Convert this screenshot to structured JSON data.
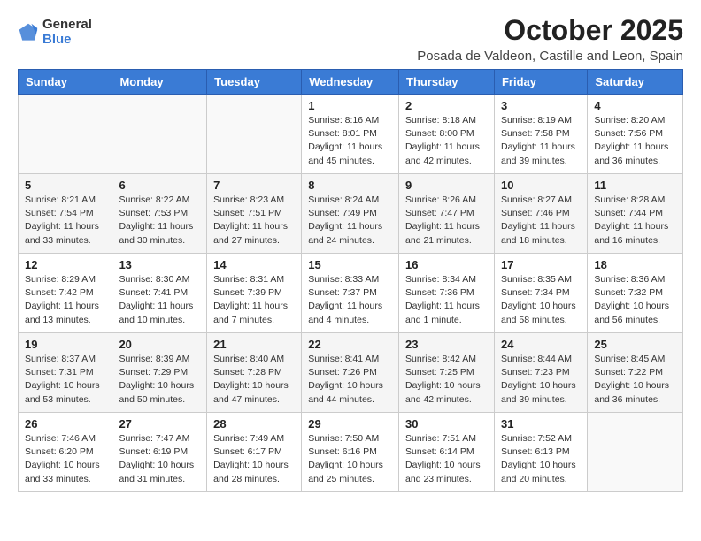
{
  "header": {
    "logo_general": "General",
    "logo_blue": "Blue",
    "title": "October 2025",
    "subtitle": "Posada de Valdeon, Castille and Leon, Spain"
  },
  "weekdays": [
    "Sunday",
    "Monday",
    "Tuesday",
    "Wednesday",
    "Thursday",
    "Friday",
    "Saturday"
  ],
  "weeks": [
    [
      {
        "day": "",
        "info": ""
      },
      {
        "day": "",
        "info": ""
      },
      {
        "day": "",
        "info": ""
      },
      {
        "day": "1",
        "info": "Sunrise: 8:16 AM\nSunset: 8:01 PM\nDaylight: 11 hours and 45 minutes."
      },
      {
        "day": "2",
        "info": "Sunrise: 8:18 AM\nSunset: 8:00 PM\nDaylight: 11 hours and 42 minutes."
      },
      {
        "day": "3",
        "info": "Sunrise: 8:19 AM\nSunset: 7:58 PM\nDaylight: 11 hours and 39 minutes."
      },
      {
        "day": "4",
        "info": "Sunrise: 8:20 AM\nSunset: 7:56 PM\nDaylight: 11 hours and 36 minutes."
      }
    ],
    [
      {
        "day": "5",
        "info": "Sunrise: 8:21 AM\nSunset: 7:54 PM\nDaylight: 11 hours and 33 minutes."
      },
      {
        "day": "6",
        "info": "Sunrise: 8:22 AM\nSunset: 7:53 PM\nDaylight: 11 hours and 30 minutes."
      },
      {
        "day": "7",
        "info": "Sunrise: 8:23 AM\nSunset: 7:51 PM\nDaylight: 11 hours and 27 minutes."
      },
      {
        "day": "8",
        "info": "Sunrise: 8:24 AM\nSunset: 7:49 PM\nDaylight: 11 hours and 24 minutes."
      },
      {
        "day": "9",
        "info": "Sunrise: 8:26 AM\nSunset: 7:47 PM\nDaylight: 11 hours and 21 minutes."
      },
      {
        "day": "10",
        "info": "Sunrise: 8:27 AM\nSunset: 7:46 PM\nDaylight: 11 hours and 18 minutes."
      },
      {
        "day": "11",
        "info": "Sunrise: 8:28 AM\nSunset: 7:44 PM\nDaylight: 11 hours and 16 minutes."
      }
    ],
    [
      {
        "day": "12",
        "info": "Sunrise: 8:29 AM\nSunset: 7:42 PM\nDaylight: 11 hours and 13 minutes."
      },
      {
        "day": "13",
        "info": "Sunrise: 8:30 AM\nSunset: 7:41 PM\nDaylight: 11 hours and 10 minutes."
      },
      {
        "day": "14",
        "info": "Sunrise: 8:31 AM\nSunset: 7:39 PM\nDaylight: 11 hours and 7 minutes."
      },
      {
        "day": "15",
        "info": "Sunrise: 8:33 AM\nSunset: 7:37 PM\nDaylight: 11 hours and 4 minutes."
      },
      {
        "day": "16",
        "info": "Sunrise: 8:34 AM\nSunset: 7:36 PM\nDaylight: 11 hours and 1 minute."
      },
      {
        "day": "17",
        "info": "Sunrise: 8:35 AM\nSunset: 7:34 PM\nDaylight: 10 hours and 58 minutes."
      },
      {
        "day": "18",
        "info": "Sunrise: 8:36 AM\nSunset: 7:32 PM\nDaylight: 10 hours and 56 minutes."
      }
    ],
    [
      {
        "day": "19",
        "info": "Sunrise: 8:37 AM\nSunset: 7:31 PM\nDaylight: 10 hours and 53 minutes."
      },
      {
        "day": "20",
        "info": "Sunrise: 8:39 AM\nSunset: 7:29 PM\nDaylight: 10 hours and 50 minutes."
      },
      {
        "day": "21",
        "info": "Sunrise: 8:40 AM\nSunset: 7:28 PM\nDaylight: 10 hours and 47 minutes."
      },
      {
        "day": "22",
        "info": "Sunrise: 8:41 AM\nSunset: 7:26 PM\nDaylight: 10 hours and 44 minutes."
      },
      {
        "day": "23",
        "info": "Sunrise: 8:42 AM\nSunset: 7:25 PM\nDaylight: 10 hours and 42 minutes."
      },
      {
        "day": "24",
        "info": "Sunrise: 8:44 AM\nSunset: 7:23 PM\nDaylight: 10 hours and 39 minutes."
      },
      {
        "day": "25",
        "info": "Sunrise: 8:45 AM\nSunset: 7:22 PM\nDaylight: 10 hours and 36 minutes."
      }
    ],
    [
      {
        "day": "26",
        "info": "Sunrise: 7:46 AM\nSunset: 6:20 PM\nDaylight: 10 hours and 33 minutes."
      },
      {
        "day": "27",
        "info": "Sunrise: 7:47 AM\nSunset: 6:19 PM\nDaylight: 10 hours and 31 minutes."
      },
      {
        "day": "28",
        "info": "Sunrise: 7:49 AM\nSunset: 6:17 PM\nDaylight: 10 hours and 28 minutes."
      },
      {
        "day": "29",
        "info": "Sunrise: 7:50 AM\nSunset: 6:16 PM\nDaylight: 10 hours and 25 minutes."
      },
      {
        "day": "30",
        "info": "Sunrise: 7:51 AM\nSunset: 6:14 PM\nDaylight: 10 hours and 23 minutes."
      },
      {
        "day": "31",
        "info": "Sunrise: 7:52 AM\nSunset: 6:13 PM\nDaylight: 10 hours and 20 minutes."
      },
      {
        "day": "",
        "info": ""
      }
    ]
  ]
}
